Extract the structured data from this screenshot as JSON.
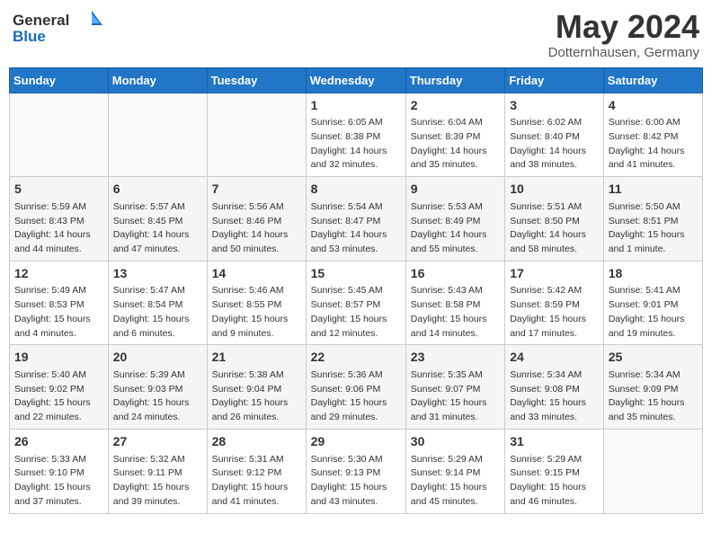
{
  "header": {
    "logo_general": "General",
    "logo_blue": "Blue",
    "title": "May 2024",
    "subtitle": "Dotternhausen, Germany"
  },
  "days_of_week": [
    "Sunday",
    "Monday",
    "Tuesday",
    "Wednesday",
    "Thursday",
    "Friday",
    "Saturday"
  ],
  "weeks": [
    [
      {
        "day": "",
        "sunrise": "",
        "sunset": "",
        "daylight": ""
      },
      {
        "day": "",
        "sunrise": "",
        "sunset": "",
        "daylight": ""
      },
      {
        "day": "",
        "sunrise": "",
        "sunset": "",
        "daylight": ""
      },
      {
        "day": "1",
        "sunrise": "Sunrise: 6:05 AM",
        "sunset": "Sunset: 8:38 PM",
        "daylight": "Daylight: 14 hours and 32 minutes."
      },
      {
        "day": "2",
        "sunrise": "Sunrise: 6:04 AM",
        "sunset": "Sunset: 8:39 PM",
        "daylight": "Daylight: 14 hours and 35 minutes."
      },
      {
        "day": "3",
        "sunrise": "Sunrise: 6:02 AM",
        "sunset": "Sunset: 8:40 PM",
        "daylight": "Daylight: 14 hours and 38 minutes."
      },
      {
        "day": "4",
        "sunrise": "Sunrise: 6:00 AM",
        "sunset": "Sunset: 8:42 PM",
        "daylight": "Daylight: 14 hours and 41 minutes."
      }
    ],
    [
      {
        "day": "5",
        "sunrise": "Sunrise: 5:59 AM",
        "sunset": "Sunset: 8:43 PM",
        "daylight": "Daylight: 14 hours and 44 minutes."
      },
      {
        "day": "6",
        "sunrise": "Sunrise: 5:57 AM",
        "sunset": "Sunset: 8:45 PM",
        "daylight": "Daylight: 14 hours and 47 minutes."
      },
      {
        "day": "7",
        "sunrise": "Sunrise: 5:56 AM",
        "sunset": "Sunset: 8:46 PM",
        "daylight": "Daylight: 14 hours and 50 minutes."
      },
      {
        "day": "8",
        "sunrise": "Sunrise: 5:54 AM",
        "sunset": "Sunset: 8:47 PM",
        "daylight": "Daylight: 14 hours and 53 minutes."
      },
      {
        "day": "9",
        "sunrise": "Sunrise: 5:53 AM",
        "sunset": "Sunset: 8:49 PM",
        "daylight": "Daylight: 14 hours and 55 minutes."
      },
      {
        "day": "10",
        "sunrise": "Sunrise: 5:51 AM",
        "sunset": "Sunset: 8:50 PM",
        "daylight": "Daylight: 14 hours and 58 minutes."
      },
      {
        "day": "11",
        "sunrise": "Sunrise: 5:50 AM",
        "sunset": "Sunset: 8:51 PM",
        "daylight": "Daylight: 15 hours and 1 minute."
      }
    ],
    [
      {
        "day": "12",
        "sunrise": "Sunrise: 5:49 AM",
        "sunset": "Sunset: 8:53 PM",
        "daylight": "Daylight: 15 hours and 4 minutes."
      },
      {
        "day": "13",
        "sunrise": "Sunrise: 5:47 AM",
        "sunset": "Sunset: 8:54 PM",
        "daylight": "Daylight: 15 hours and 6 minutes."
      },
      {
        "day": "14",
        "sunrise": "Sunrise: 5:46 AM",
        "sunset": "Sunset: 8:55 PM",
        "daylight": "Daylight: 15 hours and 9 minutes."
      },
      {
        "day": "15",
        "sunrise": "Sunrise: 5:45 AM",
        "sunset": "Sunset: 8:57 PM",
        "daylight": "Daylight: 15 hours and 12 minutes."
      },
      {
        "day": "16",
        "sunrise": "Sunrise: 5:43 AM",
        "sunset": "Sunset: 8:58 PM",
        "daylight": "Daylight: 15 hours and 14 minutes."
      },
      {
        "day": "17",
        "sunrise": "Sunrise: 5:42 AM",
        "sunset": "Sunset: 8:59 PM",
        "daylight": "Daylight: 15 hours and 17 minutes."
      },
      {
        "day": "18",
        "sunrise": "Sunrise: 5:41 AM",
        "sunset": "Sunset: 9:01 PM",
        "daylight": "Daylight: 15 hours and 19 minutes."
      }
    ],
    [
      {
        "day": "19",
        "sunrise": "Sunrise: 5:40 AM",
        "sunset": "Sunset: 9:02 PM",
        "daylight": "Daylight: 15 hours and 22 minutes."
      },
      {
        "day": "20",
        "sunrise": "Sunrise: 5:39 AM",
        "sunset": "Sunset: 9:03 PM",
        "daylight": "Daylight: 15 hours and 24 minutes."
      },
      {
        "day": "21",
        "sunrise": "Sunrise: 5:38 AM",
        "sunset": "Sunset: 9:04 PM",
        "daylight": "Daylight: 15 hours and 26 minutes."
      },
      {
        "day": "22",
        "sunrise": "Sunrise: 5:36 AM",
        "sunset": "Sunset: 9:06 PM",
        "daylight": "Daylight: 15 hours and 29 minutes."
      },
      {
        "day": "23",
        "sunrise": "Sunrise: 5:35 AM",
        "sunset": "Sunset: 9:07 PM",
        "daylight": "Daylight: 15 hours and 31 minutes."
      },
      {
        "day": "24",
        "sunrise": "Sunrise: 5:34 AM",
        "sunset": "Sunset: 9:08 PM",
        "daylight": "Daylight: 15 hours and 33 minutes."
      },
      {
        "day": "25",
        "sunrise": "Sunrise: 5:34 AM",
        "sunset": "Sunset: 9:09 PM",
        "daylight": "Daylight: 15 hours and 35 minutes."
      }
    ],
    [
      {
        "day": "26",
        "sunrise": "Sunrise: 5:33 AM",
        "sunset": "Sunset: 9:10 PM",
        "daylight": "Daylight: 15 hours and 37 minutes."
      },
      {
        "day": "27",
        "sunrise": "Sunrise: 5:32 AM",
        "sunset": "Sunset: 9:11 PM",
        "daylight": "Daylight: 15 hours and 39 minutes."
      },
      {
        "day": "28",
        "sunrise": "Sunrise: 5:31 AM",
        "sunset": "Sunset: 9:12 PM",
        "daylight": "Daylight: 15 hours and 41 minutes."
      },
      {
        "day": "29",
        "sunrise": "Sunrise: 5:30 AM",
        "sunset": "Sunset: 9:13 PM",
        "daylight": "Daylight: 15 hours and 43 minutes."
      },
      {
        "day": "30",
        "sunrise": "Sunrise: 5:29 AM",
        "sunset": "Sunset: 9:14 PM",
        "daylight": "Daylight: 15 hours and 45 minutes."
      },
      {
        "day": "31",
        "sunrise": "Sunrise: 5:29 AM",
        "sunset": "Sunset: 9:15 PM",
        "daylight": "Daylight: 15 hours and 46 minutes."
      },
      {
        "day": "",
        "sunrise": "",
        "sunset": "",
        "daylight": ""
      }
    ]
  ]
}
